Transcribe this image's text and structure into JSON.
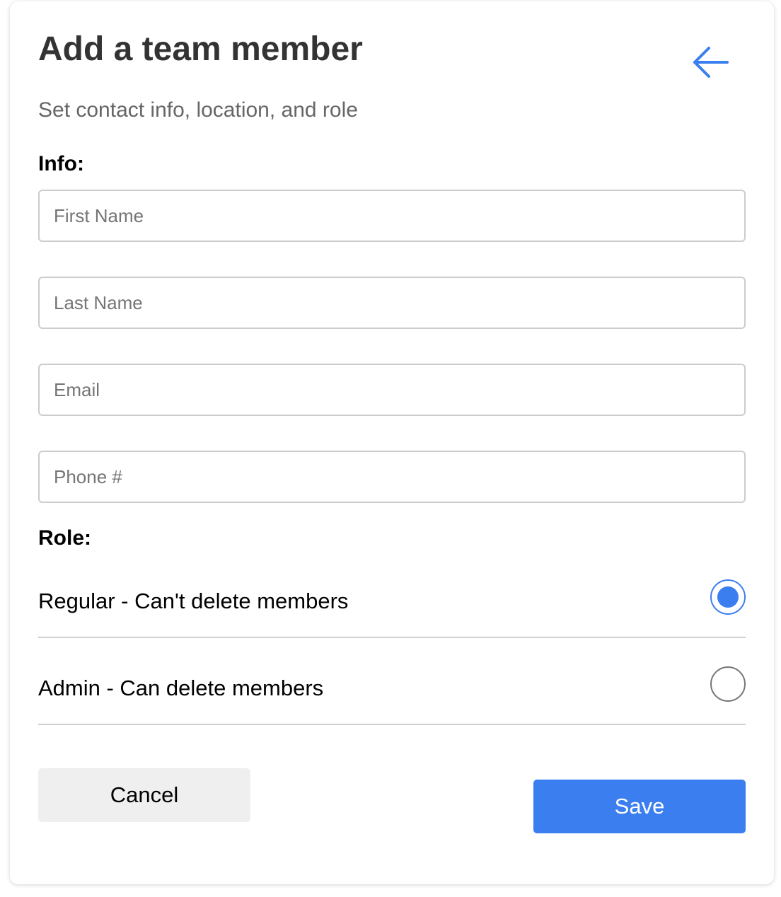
{
  "header": {
    "title": "Add a team member",
    "subtitle": "Set contact info, location, and role",
    "back_icon": "arrow-left-icon"
  },
  "info_section": {
    "label": "Info:",
    "fields": {
      "first_name": {
        "placeholder": "First Name",
        "value": ""
      },
      "last_name": {
        "placeholder": "Last Name",
        "value": ""
      },
      "email": {
        "placeholder": "Email",
        "value": ""
      },
      "phone": {
        "placeholder": "Phone #",
        "value": ""
      }
    }
  },
  "role_section": {
    "label": "Role:",
    "options": [
      {
        "label": "Regular - Can't delete members",
        "selected": true
      },
      {
        "label": "Admin - Can delete members",
        "selected": false
      }
    ]
  },
  "actions": {
    "cancel_label": "Cancel",
    "save_label": "Save"
  },
  "colors": {
    "accent": "#3b7ef0",
    "title_text": "#333333",
    "subtitle_text": "#666666",
    "cancel_bg": "#efefef"
  }
}
